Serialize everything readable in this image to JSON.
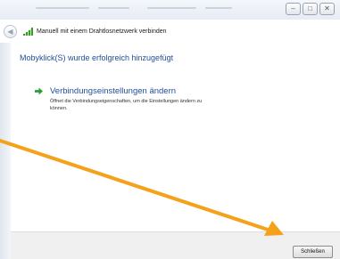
{
  "window": {
    "title": "Manuell mit einem Drahtlosnetzwerk verbinden",
    "controls": {
      "minimize": "–",
      "maximize": "□",
      "close": "✕"
    }
  },
  "main": {
    "headline": "Mobyklick(S) wurde erfolgreich hinzugefügt",
    "link": {
      "title": "Verbindungseinstellungen ändern",
      "description": "Öffnet die Verbindungseigenschaften, um die Einstellungen ändern zu können.",
      "icon": "green-arrow-icon"
    }
  },
  "footer": {
    "close_label": "Schließen"
  },
  "colors": {
    "link_blue": "#1f4e9c",
    "annotation_arrow": "#f5a11a",
    "arrow_green": "#2e9b3a"
  }
}
